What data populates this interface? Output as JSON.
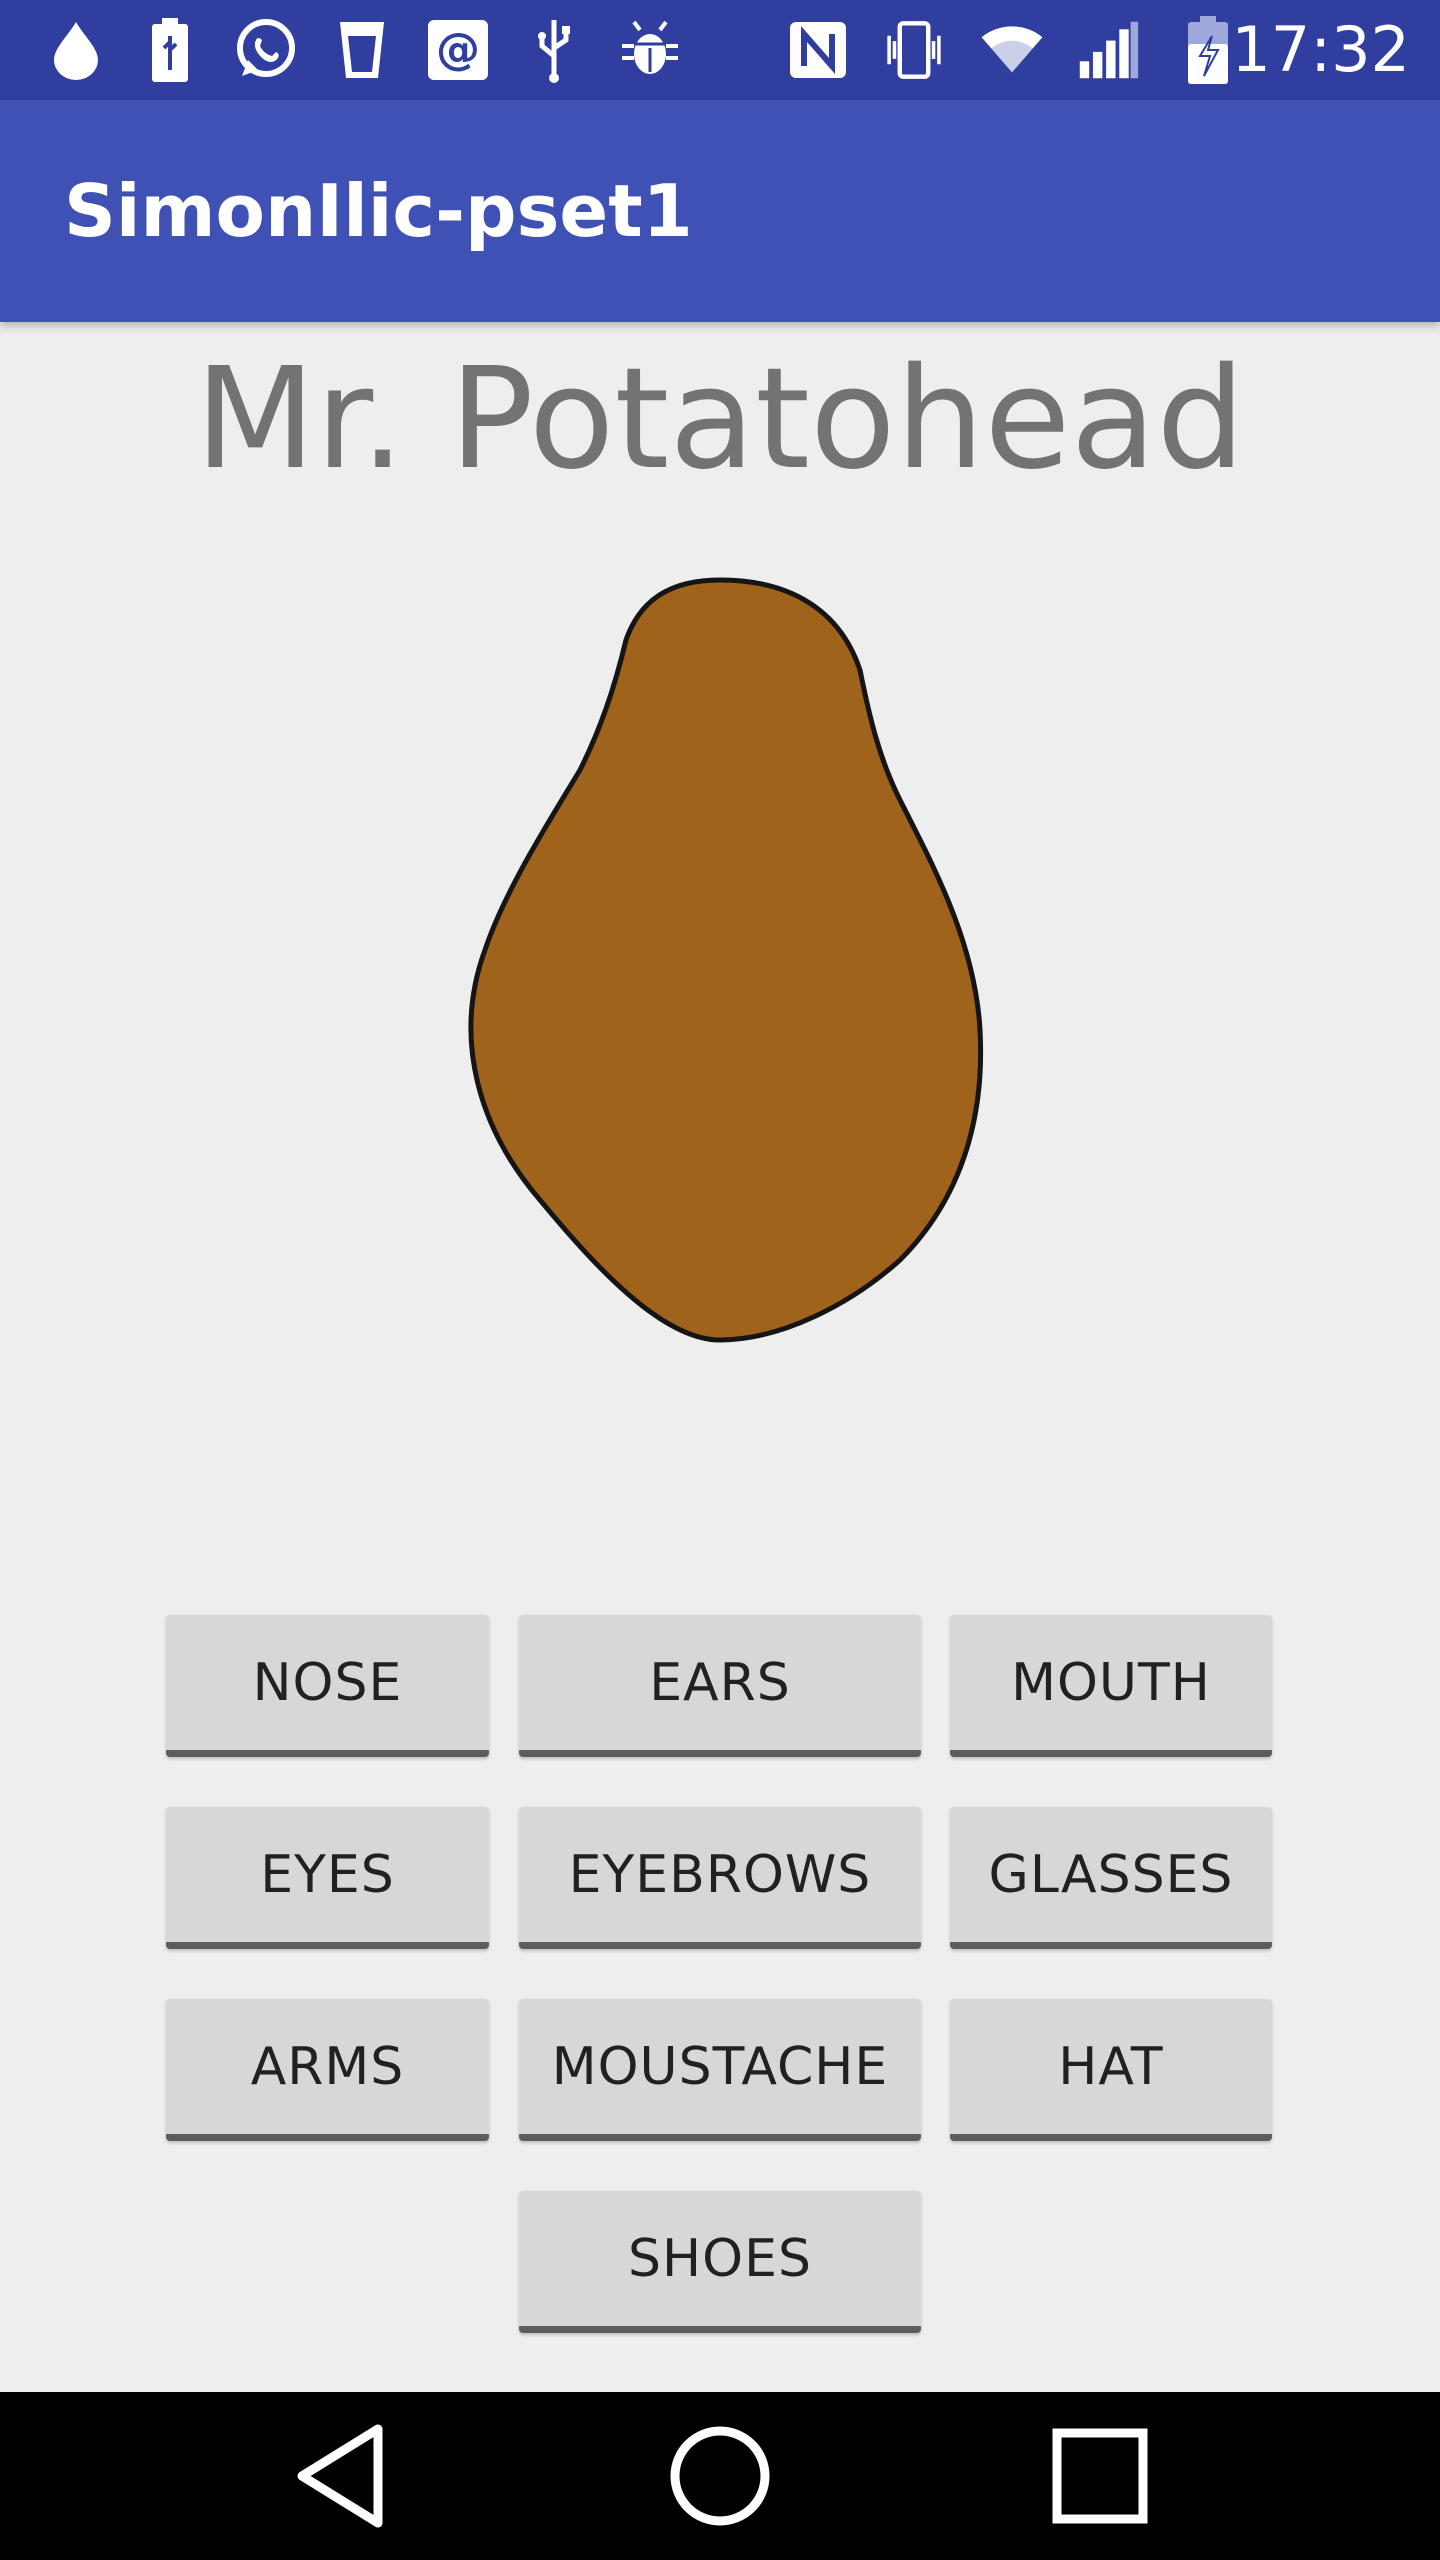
{
  "status_bar": {
    "time": "17:32",
    "icons": [
      "water-drop-icon",
      "usb-battery-icon",
      "whatsapp-icon",
      "cup-icon",
      "at-sign-icon",
      "usb-icon",
      "android-debug-icon",
      "nfc-icon",
      "vibrate-icon",
      "wifi-icon",
      "signal-icon",
      "battery-charging-icon"
    ]
  },
  "app_bar": {
    "title": "SimonIlic-pset1"
  },
  "main": {
    "heading": "Mr. Potatohead",
    "potato_color": "#a0631b"
  },
  "buttons": {
    "nose": "NOSE",
    "ears": "EARS",
    "mouth": "MOUTH",
    "eyes": "EYES",
    "eyebrows": "EYEBROWS",
    "glasses": "GLASSES",
    "arms": "ARMS",
    "moustache": "MOUSTACHE",
    "hat": "HAT",
    "shoes": "SHOES"
  },
  "nav_bar": {
    "icons": [
      "back-icon",
      "home-icon",
      "recents-icon"
    ]
  },
  "colors": {
    "status_bar": "#303f9f",
    "app_bar": "#3f51b5",
    "background": "#eeeeee"
  }
}
